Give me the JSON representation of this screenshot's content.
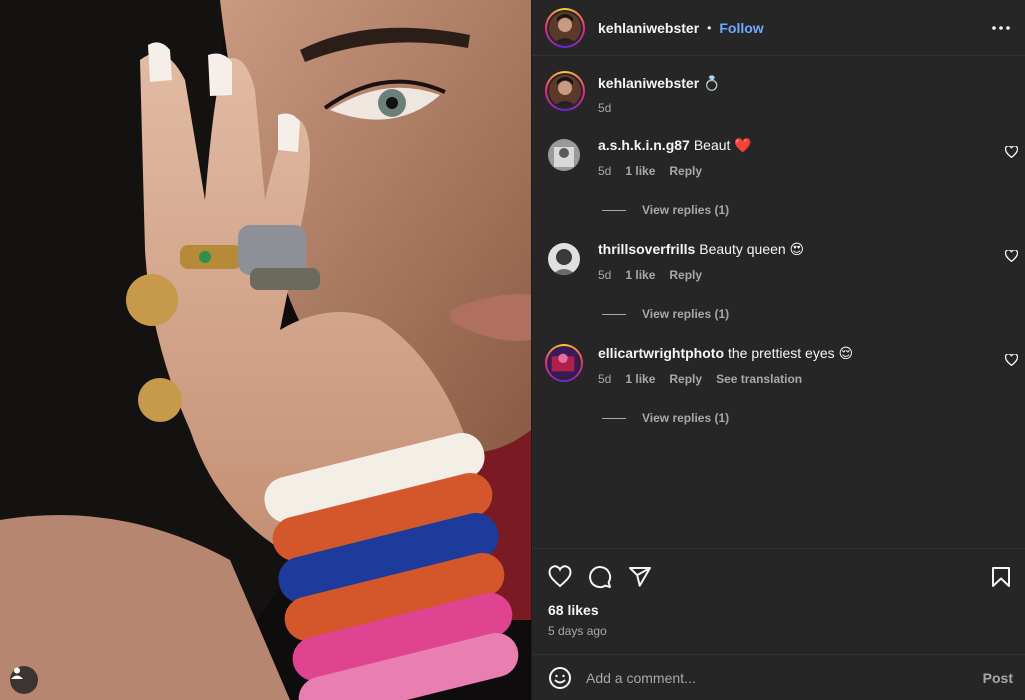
{
  "post": {
    "author": "kehlaniwebster",
    "separator": "•",
    "follow_label": "Follow",
    "caption_emoji": "💍",
    "caption_time": "5d",
    "likes": "68 likes",
    "posted_ago": "5 days ago"
  },
  "comments": [
    {
      "user": "a.s.h.k.i.n.g87",
      "text": "Beaut ❤️",
      "time": "5d",
      "likes": "1 like",
      "reply": "Reply",
      "view_replies": "View replies (1)"
    },
    {
      "user": "thrillsoverfrills",
      "text": "Beauty queen 😍",
      "time": "5d",
      "likes": "1 like",
      "reply": "Reply",
      "view_replies": "View replies (1)"
    },
    {
      "user": "ellicartwrightphoto",
      "text": "the prettiest eyes 😌",
      "time": "5d",
      "likes": "1 like",
      "reply": "Reply",
      "translate": "See translation",
      "view_replies": "View replies (1)"
    }
  ],
  "composer": {
    "placeholder": "Add a comment...",
    "post_label": "Post"
  },
  "icons": {
    "more": "more-horizontal-icon",
    "heart": "heart-icon",
    "comment": "comment-icon",
    "share": "share-icon",
    "save": "bookmark-icon",
    "emoji": "emoji-icon",
    "user_tag": "user-tag-icon"
  },
  "colors": {
    "panel_bg": "#262626",
    "text": "#f5f5f5",
    "muted": "#a8a8a8",
    "follow": "#6fa8ff"
  }
}
